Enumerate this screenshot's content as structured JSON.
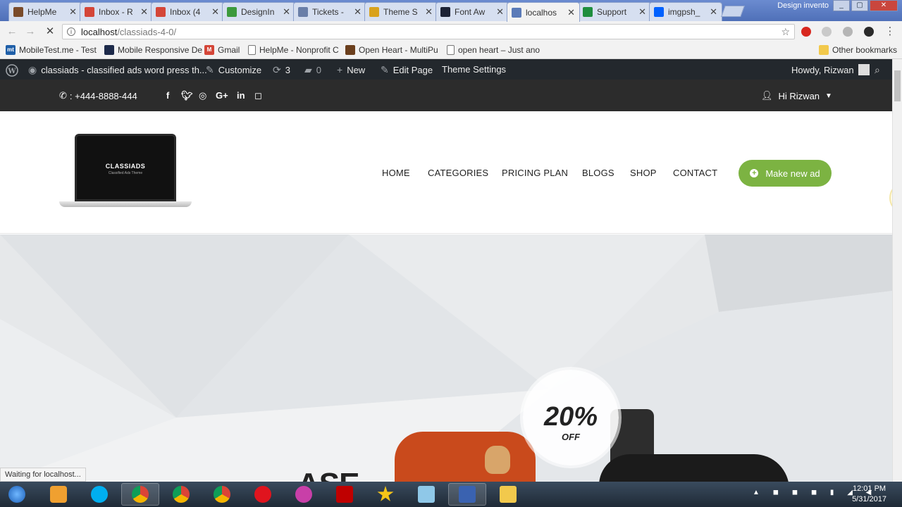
{
  "browser": {
    "tabs": [
      {
        "title": "HelpMe",
        "icon": "helpme-icon",
        "color": "#7a4b2a"
      },
      {
        "title": "Inbox - R",
        "icon": "gmail-icon",
        "color": "#d44638"
      },
      {
        "title": "Inbox (4",
        "icon": "gmail-icon",
        "color": "#d44638"
      },
      {
        "title": "DesignIn",
        "icon": "designinvento-icon",
        "color": "#3c9a3c"
      },
      {
        "title": "Tickets -",
        "icon": "tickets-icon",
        "color": "#6a7fa8"
      },
      {
        "title": "Theme S",
        "icon": "theme-icon",
        "color": "#d9a21c"
      },
      {
        "title": "Font Aw",
        "icon": "fontawesome-icon",
        "color": "#1c2235"
      },
      {
        "title": "localhos",
        "icon": "loading-icon",
        "color": "#5b7bb8"
      },
      {
        "title": "Support",
        "icon": "sheets-icon",
        "color": "#1e8e3e"
      },
      {
        "title": "imgpsh_",
        "icon": "dropbox-icon",
        "color": "#0061fe"
      }
    ],
    "profile_name": "Design invento",
    "url_host": "localhost",
    "url_path": "/classiads-4-0/",
    "status_text": "Waiting for localhost..."
  },
  "bookmarks": [
    {
      "label": "MobileTest.me - Test",
      "icon": "mt-icon",
      "color": "#1f5fa8",
      "glyph": "mt"
    },
    {
      "label": "Mobile Responsive De",
      "icon": "page-icon",
      "color": "#1d2a4a",
      "glyph": ""
    },
    {
      "label": "Gmail",
      "icon": "gmail-icon",
      "color": "#d44638",
      "glyph": "M"
    },
    {
      "label": "HelpMe - Nonprofit C",
      "icon": "document-icon",
      "color": "#ffffff",
      "glyph": ""
    },
    {
      "label": "Open Heart - MultiPu",
      "icon": "openheart-icon",
      "color": "#6b3f1d",
      "glyph": ""
    },
    {
      "label": "open heart – Just ano",
      "icon": "document-icon",
      "color": "#ffffff",
      "glyph": ""
    }
  ],
  "other_bookmarks": "Other bookmarks",
  "wp_admin": {
    "site_title": "classiads - classified ads word press th...",
    "customize": "Customize",
    "updates_count": "3",
    "comments_count": "0",
    "new": "New",
    "edit_page": "Edit Page",
    "theme_settings": "Theme Settings",
    "howdy": "Howdy, Rizwan"
  },
  "site": {
    "phone": ": +444-8888-444",
    "greeting": "Hi Rizwan",
    "logo_text": "CLASSIADS",
    "logo_tagline": "Classified Ads Theme",
    "nav": [
      "HOME",
      "CATEGORIES",
      "PRICING PLAN",
      "BLOGS",
      "SHOP",
      "CONTACT"
    ],
    "cta": "Make new ad",
    "accent": "#7cb342",
    "promo_percent": "20%",
    "promo_off": "OFF",
    "hero_partial_text": "ASE"
  },
  "taskbar": {
    "time": "12:01 PM",
    "date": "5/31/2017"
  }
}
